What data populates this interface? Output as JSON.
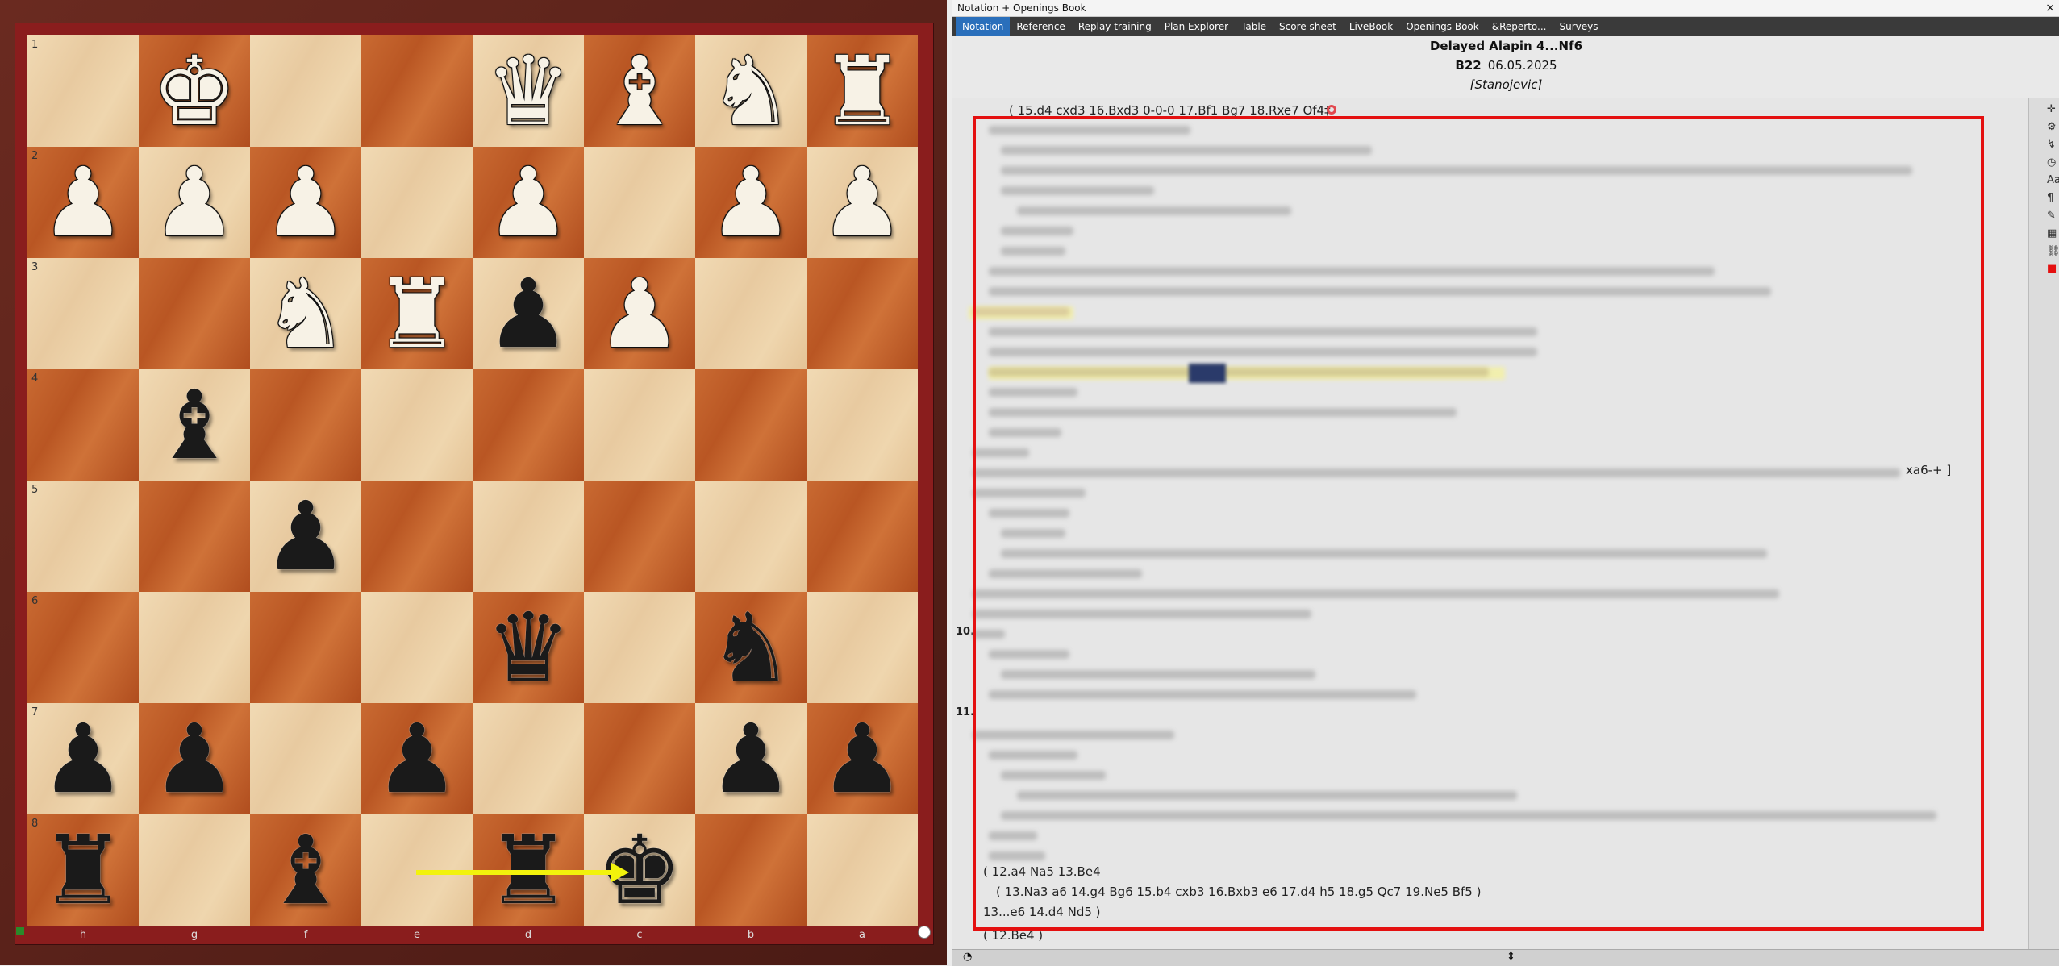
{
  "board": {
    "ranks": [
      "1",
      "2",
      "3",
      "4",
      "5",
      "6",
      "7",
      "8"
    ],
    "files": [
      "h",
      "g",
      "f",
      "e",
      "d",
      "c",
      "b",
      "a"
    ],
    "rows": [
      [
        "",
        "wK",
        "",
        "",
        "wQ",
        "wB",
        "wN",
        "wR"
      ],
      [
        "wP",
        "wP",
        "wP",
        "",
        "wP",
        "",
        "wP",
        "wP"
      ],
      [
        "",
        "",
        "wN",
        "wR",
        "bP",
        "wP",
        "",
        ""
      ],
      [
        "",
        "bB",
        "",
        "",
        "",
        "",
        "",
        ""
      ],
      [
        "",
        "",
        "bP",
        "",
        "",
        "",
        "",
        ""
      ],
      [
        "",
        "",
        "",
        "",
        "bQ",
        "",
        "bN",
        ""
      ],
      [
        "bP",
        "bP",
        "",
        "bP",
        "",
        "",
        "bP",
        "bP"
      ],
      [
        "bR",
        "",
        "bB",
        "",
        "bR",
        "bK",
        "",
        ""
      ]
    ],
    "arrow": {
      "from": "e8",
      "to": "c8",
      "color": "#f2f20c"
    }
  },
  "panel": {
    "window_title": "Notation + Openings Book",
    "close_icon": "×",
    "tabs": [
      {
        "label": "Notation",
        "active": true
      },
      {
        "label": "Reference",
        "active": false
      },
      {
        "label": "Replay training",
        "active": false
      },
      {
        "label": "Plan Explorer",
        "active": false
      },
      {
        "label": "Table",
        "active": false
      },
      {
        "label": "Score sheet",
        "active": false
      },
      {
        "label": "LiveBook",
        "active": false
      },
      {
        "label": "Openings Book",
        "active": false
      },
      {
        "label": "&Reperto...",
        "active": false
      },
      {
        "label": "Surveys",
        "active": false
      }
    ],
    "header": {
      "title": "Delayed Alapin 4...Nf6",
      "eco": "B22",
      "date": "06.05.2025",
      "players": "[Stanojevic]"
    },
    "notation": {
      "top_line": "( 15.d4  cxd3  16.Bxd3  0-0-0  17.Bf1  Bg7  18.Rxe7  Of4‡",
      "move_10": "10.",
      "move_11": "11.",
      "partial_tail": "xa6-+ ]",
      "line_12a4": "( 12.a4  Na5  13.Be4",
      "line_13na3": "( 13.Na3  a6  14.g4  Bg6  15.b4  cxb3  16.Bxb3  e6  17.d4  h5  18.g5  Qc7  19.Ne5  Bf5 )",
      "line_13e6": "13...e6  14.d4  Nd5 )",
      "line_12be4": "( 12.Be4 )"
    },
    "tools": [
      "move-icon",
      "engine-icon",
      "tree-icon",
      "clock-icon",
      "font-icon",
      "glyph-icon",
      "pen-icon",
      "board-icon",
      "link-icon",
      "color-icon"
    ]
  },
  "colors": {
    "highlight_box": "#e41010",
    "tab_active": "#2a6fbb",
    "arrow": "#f2f20c"
  }
}
